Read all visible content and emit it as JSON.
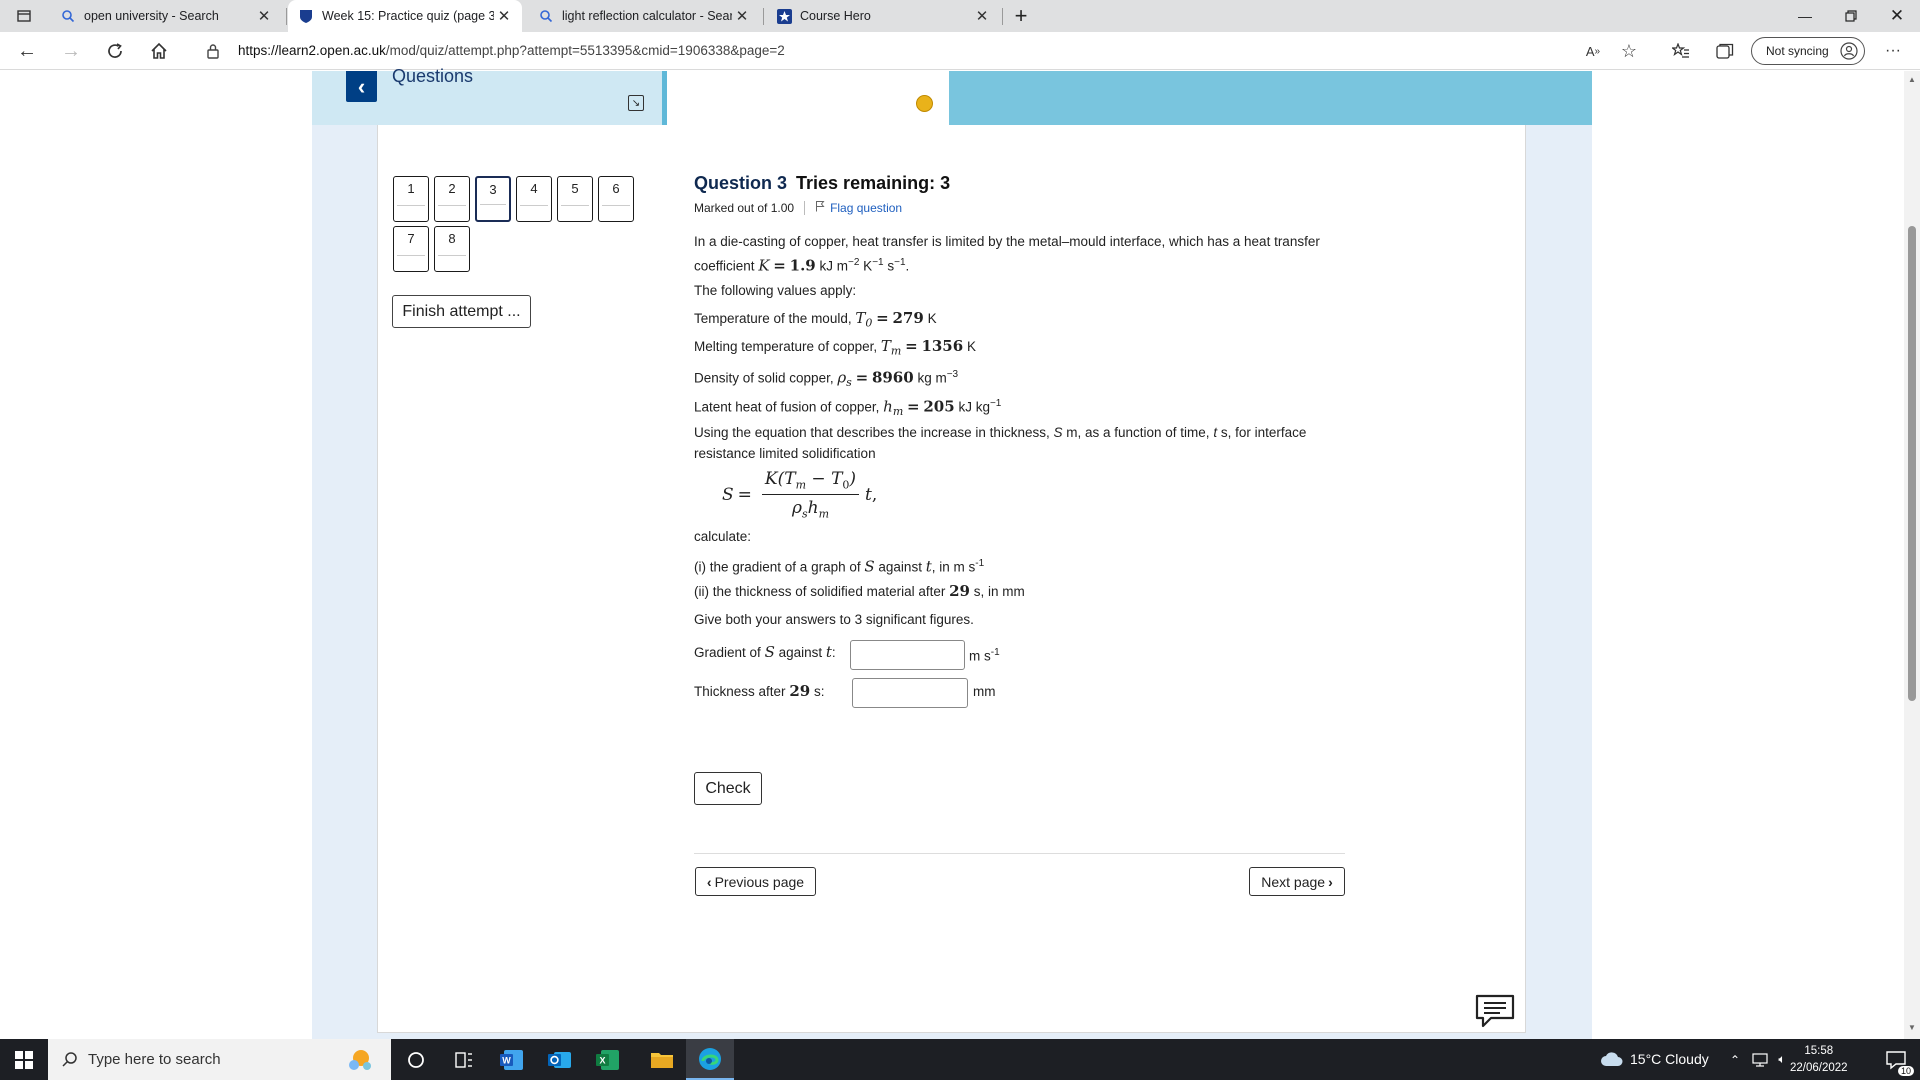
{
  "browser": {
    "tabs": [
      {
        "title": "open university - Search",
        "icon": "search-icon"
      },
      {
        "title": "Week 15: Practice quiz (page 3 o",
        "icon": "shield-icon"
      },
      {
        "title": "light reflection calculator - Searc",
        "icon": "search-icon"
      },
      {
        "title": "Course Hero",
        "icon": "course-hero-icon"
      }
    ],
    "url_host": "https://learn2.open.ac.uk",
    "url_path": "/mod/quiz/attempt.php?attempt=5513395&cmid=1906338&page=2",
    "sync_label": "Not syncing"
  },
  "quiz_nav": {
    "title": "Questions",
    "buttons": [
      "1",
      "2",
      "3",
      "4",
      "5",
      "6",
      "7",
      "8"
    ],
    "current": "3",
    "finish_label": "Finish attempt ..."
  },
  "question": {
    "number_label": "Question 3",
    "tries": "Tries remaining: 3",
    "marked": "Marked out of 1.00",
    "flag": "Flag question",
    "intro_a": "In a die-casting of copper, heat transfer is limited by the metal–mould interface, which has a heat transfer",
    "intro_b_pre": "coefficient",
    "K_sym": "K",
    "K_val": "1.9",
    "K_unit": "kJ m",
    "values_intro": "The following values apply:",
    "params": [
      {
        "label": "Temperature of the mould,",
        "sym": "T",
        "sub": "0",
        "val": "279",
        "unit": "K",
        "sup": ""
      },
      {
        "label": "Melting temperature of copper,",
        "sym": "T",
        "sub": "m",
        "val": "1356",
        "unit": "K",
        "sup": ""
      },
      {
        "label": "Density of solid copper,",
        "sym": "ρ",
        "sub": "s",
        "val": "8960",
        "unit": "kg m",
        "sup": "−3"
      },
      {
        "label": "Latent heat of fusion of copper,",
        "sym": "h",
        "sub": "m",
        "val": "205",
        "unit": "kJ kg",
        "sup": "−1"
      }
    ],
    "using_a": "Using the equation that describes the increase in thickness,",
    "using_b": "resistance limited solidification",
    "calculate": "calculate:",
    "part_i": "(i) the gradient of a graph of",
    "part_i_unit": "in m s",
    "part_ii": "(ii) the thickness of solidified material after",
    "part_ii_val": "29",
    "part_ii_unit": "s, in mm",
    "sig_figs": "Give both your answers to 3 significant figures.",
    "gradient_label": "Gradient of",
    "gradient_value": "",
    "gradient_unit": "m s",
    "thickness_label": "Thickness after",
    "thickness_value": "",
    "thickness_unit": "mm",
    "check_label": "Check",
    "prev_label": "Previous page",
    "next_label": "Next page"
  },
  "taskbar": {
    "search_placeholder": "Type here to search",
    "weather": "15°C  Cloudy",
    "time": "15:58",
    "date": "22/06/2022",
    "notification_count": "10"
  }
}
